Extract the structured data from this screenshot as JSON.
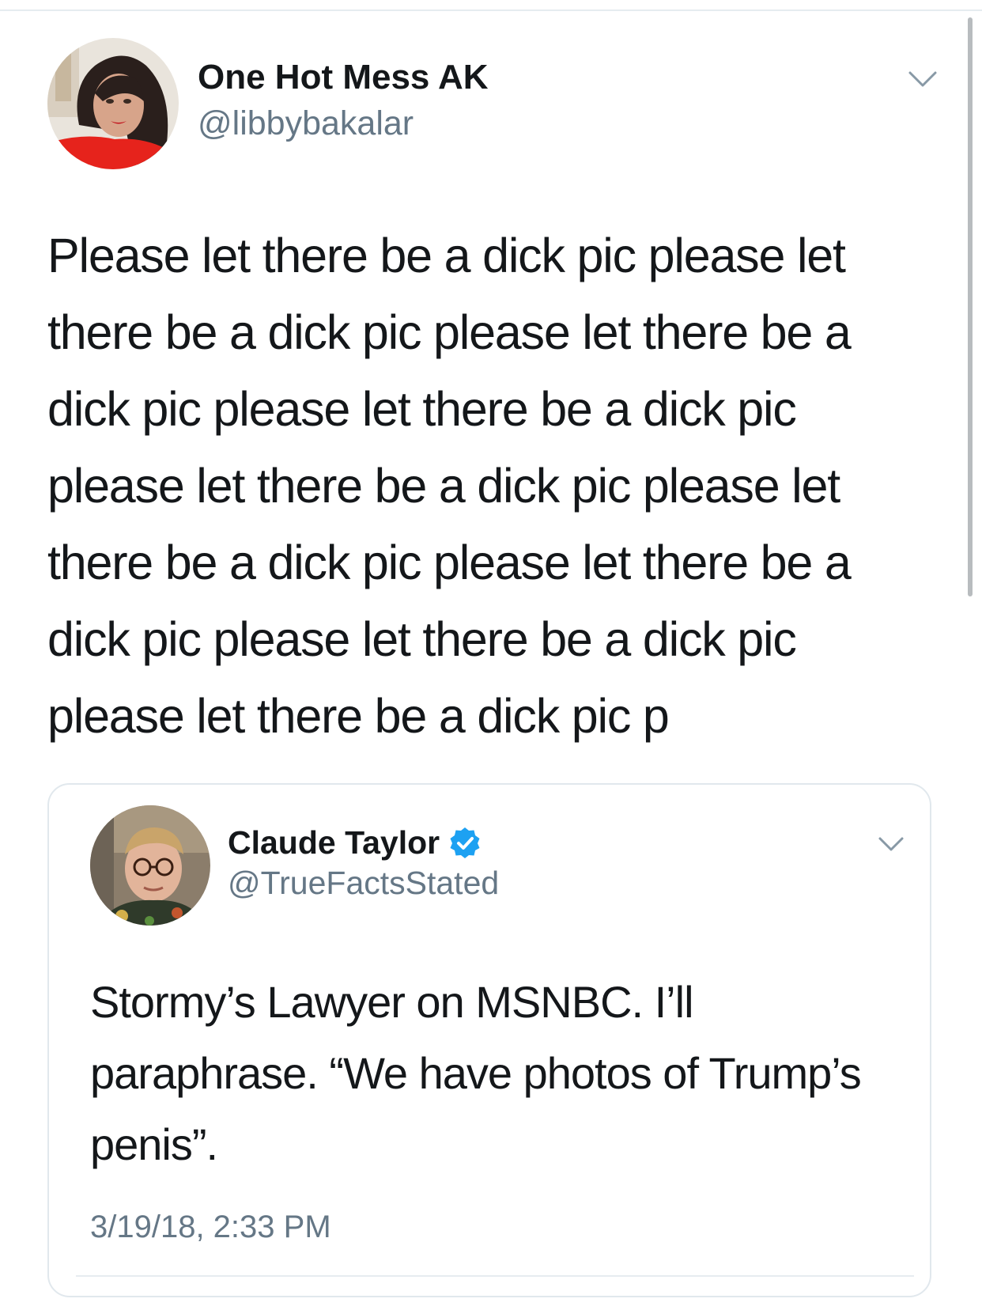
{
  "main_tweet": {
    "display_name": "One Hot Mess AK",
    "handle": "@libbybakalar",
    "text": "Please let there be a dick pic please let there be a dick pic please let there be a dick pic please let there be a dick pic please let there be a dick pic please let there be a dick pic please let there be a dick pic please let there be a dick pic please let there be a dick pic p",
    "menu_icon": "chevron-down-icon",
    "avatar_icon": "profile-photo"
  },
  "quoted_tweet": {
    "display_name": "Claude Taylor",
    "handle": "@TrueFactsStated",
    "verified": true,
    "verified_icon": "verified-badge-icon",
    "text": "Stormy’s Lawyer on MSNBC. I’ll paraphrase. “We have photos of Trump’s penis”.",
    "timestamp": "3/19/18, 2:33 PM",
    "menu_icon": "chevron-down-icon",
    "avatar_icon": "profile-photo"
  },
  "colors": {
    "text_primary": "#14171a",
    "text_secondary": "#657786",
    "border": "#e1e8ed",
    "verified_blue": "#1da1f2",
    "background": "#ffffff"
  }
}
